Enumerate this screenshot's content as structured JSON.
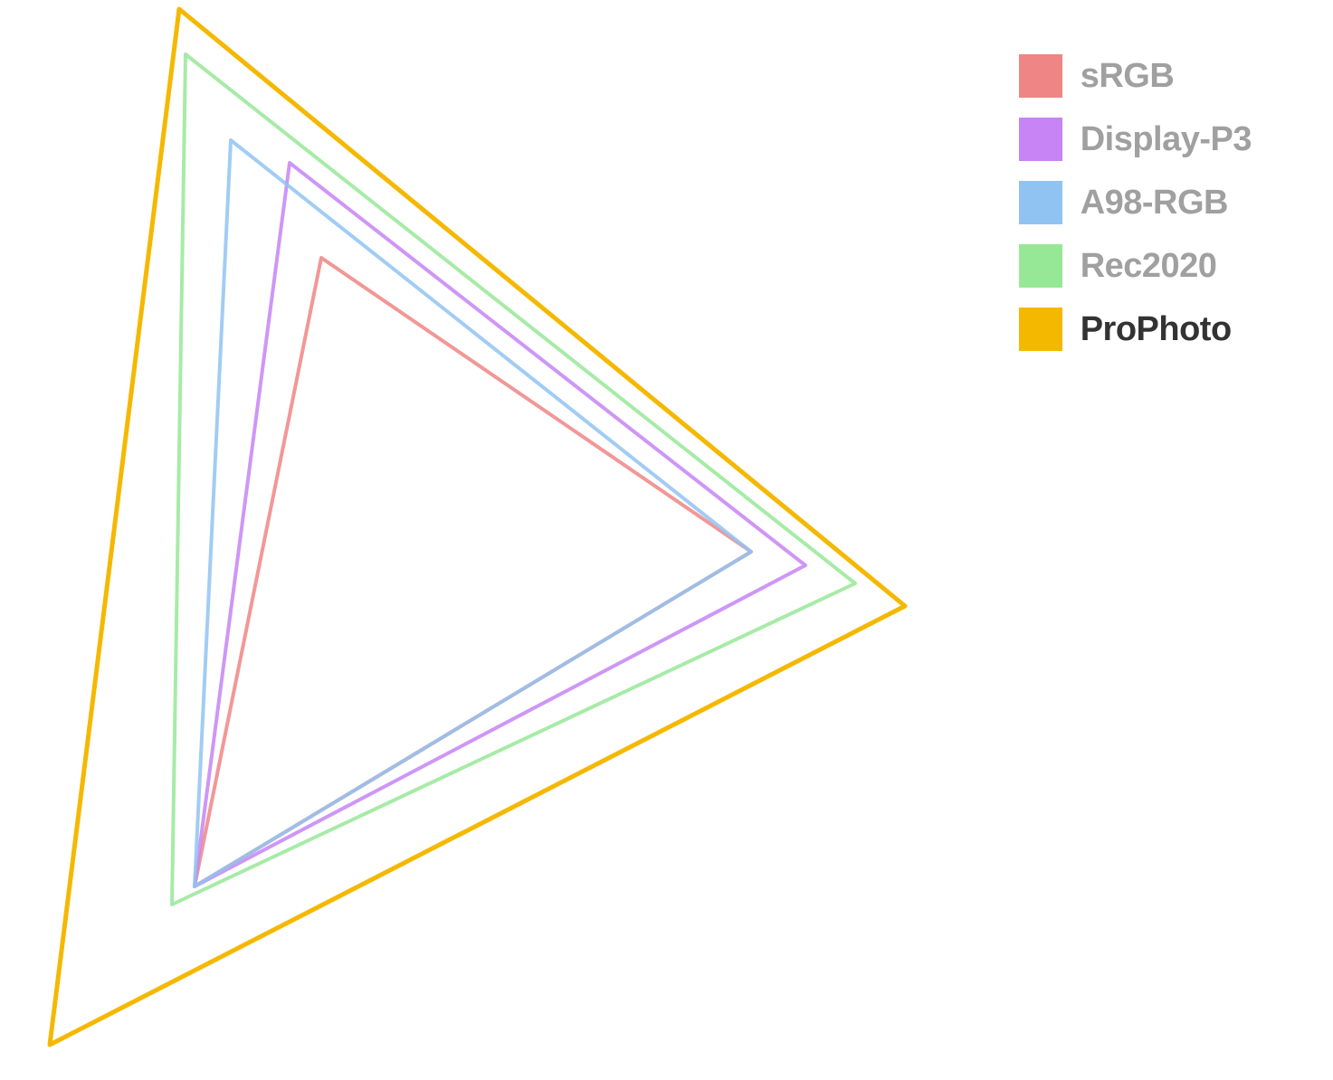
{
  "chart_data": {
    "type": "line",
    "title": "",
    "description": "Color gamut comparison triangles (chromaticity-style diagram) showing relative coverage of five RGB color spaces",
    "series": [
      {
        "name": "sRGB",
        "color": "#f08585",
        "active": false,
        "vertices": [
          {
            "x": 0.64,
            "y": 0.33
          },
          {
            "x": 0.3,
            "y": 0.6
          },
          {
            "x": 0.15,
            "y": 0.06
          }
        ]
      },
      {
        "name": "Display-P3",
        "color": "#c684f5",
        "active": false,
        "vertices": [
          {
            "x": 0.68,
            "y": 0.32
          },
          {
            "x": 0.265,
            "y": 0.69
          },
          {
            "x": 0.15,
            "y": 0.06
          }
        ]
      },
      {
        "name": "A98-RGB",
        "color": "#90c3f2",
        "active": false,
        "vertices": [
          {
            "x": 0.64,
            "y": 0.33
          },
          {
            "x": 0.21,
            "y": 0.71
          },
          {
            "x": 0.15,
            "y": 0.06
          }
        ]
      },
      {
        "name": "Rec2020",
        "color": "#97e896",
        "active": false,
        "vertices": [
          {
            "x": 0.708,
            "y": 0.292
          },
          {
            "x": 0.17,
            "y": 0.797
          },
          {
            "x": 0.131,
            "y": 0.046
          }
        ]
      },
      {
        "name": "ProPhoto",
        "color": "#f5b800",
        "active": true,
        "vertices": [
          {
            "x": 0.7347,
            "y": 0.2653
          },
          {
            "x": 0.1596,
            "y": 0.8404
          },
          {
            "x": 0.0366,
            "y": 0.0001
          }
        ]
      }
    ],
    "xlim": [
      0,
      0.8
    ],
    "ylim": [
      0,
      0.9
    ]
  },
  "legend": {
    "items": [
      {
        "label": "sRGB",
        "color": "#f08585",
        "active": false
      },
      {
        "label": "Display-P3",
        "color": "#c684f5",
        "active": false
      },
      {
        "label": "A98-RGB",
        "color": "#90c3f2",
        "active": false
      },
      {
        "label": "Rec2020",
        "color": "#97e896",
        "active": false
      },
      {
        "label": "ProPhoto",
        "color": "#f5b800",
        "active": true
      }
    ]
  }
}
